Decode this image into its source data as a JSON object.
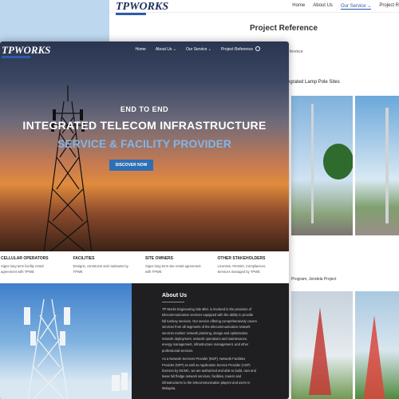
{
  "back_page": {
    "logo": "TPWORKS",
    "menu": [
      "Home",
      "About Us",
      "Our Service ⌄",
      "Project R"
    ],
    "title": "Project Reference",
    "breadcrumb": "ference",
    "section1": "ntegrated Lamp Pole Sites",
    "section2": "Program, Jendela Project"
  },
  "front_page": {
    "logo": "TPWORKS",
    "menu": [
      "Home",
      "About Us ⌄",
      "Our Service ⌄",
      "Project Reference"
    ],
    "hero": {
      "line1": "END TO END",
      "line2": "INTEGRATED TELECOM INFRASTRUCTURE",
      "line3": "SERVICE & FACILITY PROVIDER",
      "cta": "DISCOVER NOW"
    },
    "cards": [
      {
        "title": "CELLULAR OPERATORS",
        "text": "Signs long term facility rental agreement with TPWE"
      },
      {
        "title": "FACILITIES",
        "text": "Designs, constructs and maintains by TPWE"
      },
      {
        "title": "SITE OWNERS",
        "text": "Signs long term site rental agreement with TPWE"
      },
      {
        "title": "OTHER STAKEHOLDERS",
        "text": "Licenses, Permits, Compliances, Services managed by TPWE"
      }
    ],
    "about": {
      "title": "About Us",
      "p1": "TP Works Engineering Sdn Bhd. is involved in the provision of telecommunication services equipped with the ability to provide full turnkey services. Our service offering comprehensively covers services from all segments of the telecommunication network services market: network planning, design and optimisation, network deployment, network operations and maintenance, energy management, infrastructure management, and other professional services.",
      "p2": "As a Network Services Provider (NSP), Network Facilities Provider (NFP) as well as Application Service Provider (ASP) licenses by MCMC, we are authorized and able to build, own and lease full fledge network services, facilities, towers and infrastructures to the telecommunication players and users in Malaysia."
    }
  }
}
